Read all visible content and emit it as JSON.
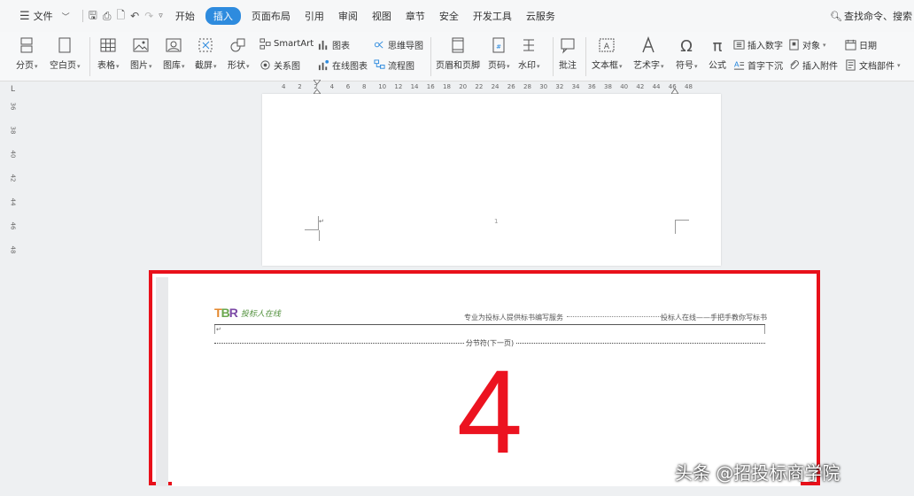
{
  "menu": {
    "file": "文件",
    "tabs": [
      "开始",
      "插入",
      "页面布局",
      "引用",
      "审阅",
      "视图",
      "章节",
      "安全",
      "开发工具",
      "云服务"
    ],
    "active_tab": "插入",
    "search": "查找命令、搜索"
  },
  "ribbon": {
    "page_break": "分页",
    "blank_page": "空白页",
    "table": "表格",
    "picture": "图片",
    "gallery": "图库",
    "screenshot": "截屏",
    "shapes": "形状",
    "smartart": "SmartArt",
    "chart": "图表",
    "mindmap": "思维导图",
    "relation": "关系图",
    "online_chart": "在线图表",
    "flowchart": "流程图",
    "header_footer": "页眉和页脚",
    "page_number": "页码",
    "watermark": "水印",
    "comment": "批注",
    "textbox": "文本框",
    "wordart": "艺术字",
    "symbol": "符号",
    "formula": "公式",
    "insert_number": "插入数字",
    "drop_cap": "首字下沉",
    "object": "对象",
    "attachment": "插入附件",
    "date": "日期",
    "doc_parts": "文档部件"
  },
  "ruler_ticks": [
    "4",
    "2",
    "2",
    "4",
    "6",
    "8",
    "10",
    "12",
    "14",
    "16",
    "18",
    "20",
    "22",
    "24",
    "26",
    "28",
    "30",
    "32",
    "34",
    "36",
    "38",
    "40",
    "42",
    "44",
    "46",
    "48"
  ],
  "vruler_ticks": [
    "36",
    "38",
    "40",
    "42",
    "44",
    "46",
    "48"
  ],
  "page1": {
    "number": "1"
  },
  "page2": {
    "logo_letters": "TBR",
    "logo_text": "投标人在线",
    "header_left": "专业为投标人提供标书编写服务",
    "header_right": "投标人在线——手把手教你写标书",
    "section_break": "分节符(下一页)",
    "big_number": "4"
  },
  "watermark_text": "头条 @招投标商学院",
  "colors": {
    "accent": "#2e8bde",
    "highlight": "#e8101a",
    "big_number": "#ec1320"
  }
}
